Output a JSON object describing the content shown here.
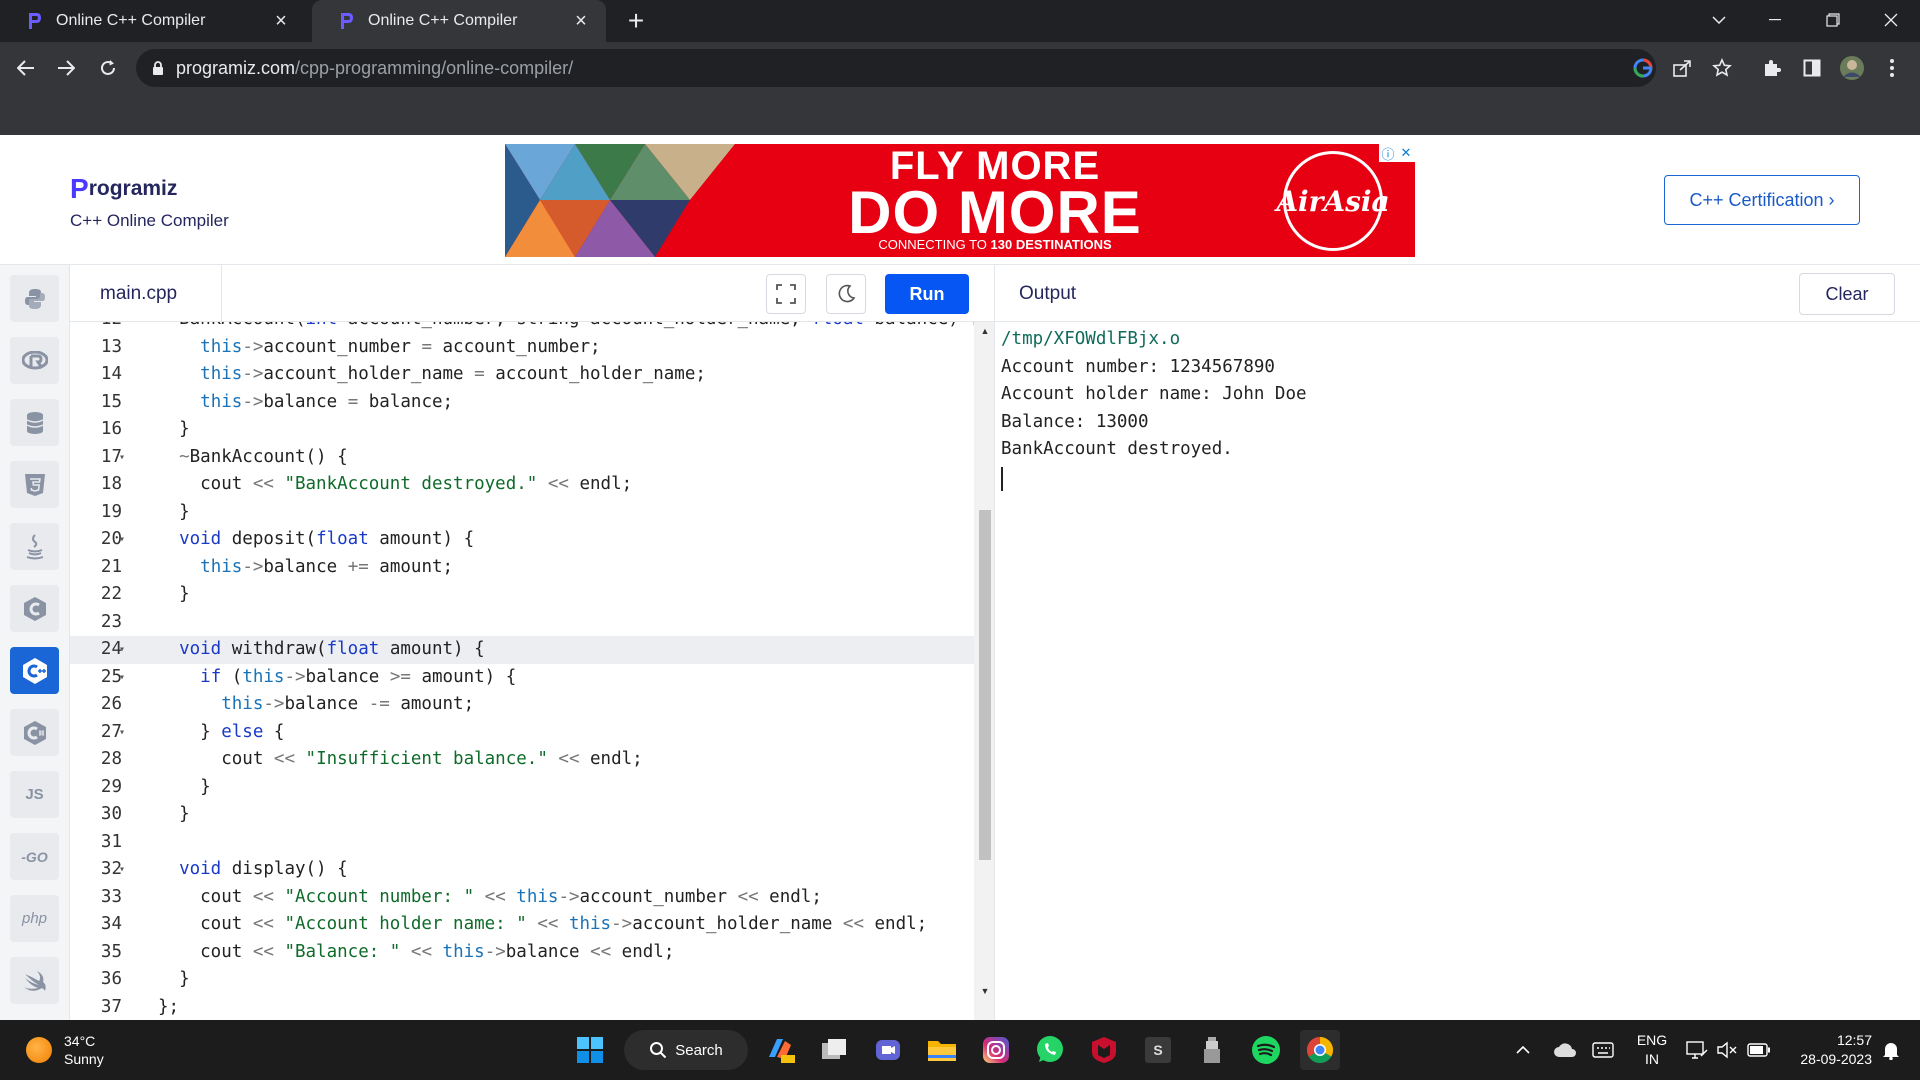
{
  "browser": {
    "tabs": [
      {
        "title": "Online C++ Compiler",
        "active": false
      },
      {
        "title": "Online C++ Compiler",
        "active": true
      }
    ],
    "url_host": "programiz.com",
    "url_path": "/cpp-programming/online-compiler/"
  },
  "site": {
    "logo_text": "rogramiz",
    "logo_letter": "P",
    "subtitle": "C++ Online Compiler",
    "certification_label": "C++ Certification",
    "ad": {
      "line1": "FLY MORE",
      "line2": "DO MORE",
      "line3_prefix": "CONNECTING TO ",
      "line3_bold": "130 DESTINATIONS",
      "brand": "AirAsia"
    }
  },
  "languages": [
    {
      "name": "python",
      "label": ""
    },
    {
      "name": "r",
      "label": ""
    },
    {
      "name": "sql",
      "label": ""
    },
    {
      "name": "html",
      "label": ""
    },
    {
      "name": "java",
      "label": ""
    },
    {
      "name": "c",
      "label": ""
    },
    {
      "name": "cpp",
      "label": "",
      "active": true
    },
    {
      "name": "csharp",
      "label": ""
    },
    {
      "name": "javascript",
      "label": "JS"
    },
    {
      "name": "go",
      "label": "-GO"
    },
    {
      "name": "php",
      "label": "php"
    },
    {
      "name": "swift",
      "label": ""
    }
  ],
  "editor": {
    "file_name": "main.cpp",
    "run_label": "Run",
    "current_line": 24,
    "lines": [
      {
        "n": "12",
        "fold": false,
        "html": "  BankAccount(<span class=\"kw\">int</span> account_number, string account_holder_name, <span class=\"kw\">float</span> balance) {"
      },
      {
        "n": "13",
        "fold": false,
        "html": "    <span class=\"th\">this</span><span class=\"op\">-></span>account_number <span class=\"op\">=</span> account_number;"
      },
      {
        "n": "14",
        "fold": false,
        "html": "    <span class=\"th\">this</span><span class=\"op\">-></span>account_holder_name <span class=\"op\">=</span> account_holder_name;"
      },
      {
        "n": "15",
        "fold": false,
        "html": "    <span class=\"th\">this</span><span class=\"op\">-></span>balance <span class=\"op\">=</span> balance;"
      },
      {
        "n": "16",
        "fold": false,
        "html": "  }"
      },
      {
        "n": "17",
        "fold": true,
        "html": "  <span class=\"op\">~</span>BankAccount() {"
      },
      {
        "n": "18",
        "fold": false,
        "html": "    cout <span class=\"op\"><<</span> <span class=\"str\">\"BankAccount destroyed.\"</span> <span class=\"op\"><<</span> endl;"
      },
      {
        "n": "19",
        "fold": false,
        "html": "  }"
      },
      {
        "n": "20",
        "fold": true,
        "html": "  <span class=\"kw\">void</span> deposit(<span class=\"kw\">float</span> amount) {"
      },
      {
        "n": "21",
        "fold": false,
        "html": "    <span class=\"th\">this</span><span class=\"op\">-></span>balance <span class=\"op\">+=</span> amount;"
      },
      {
        "n": "22",
        "fold": false,
        "html": "  }"
      },
      {
        "n": "23",
        "fold": false,
        "html": ""
      },
      {
        "n": "24",
        "fold": true,
        "html": "  <span class=\"kw\">void</span> withdraw(<span class=\"kw\">float</span> amount) {"
      },
      {
        "n": "25",
        "fold": true,
        "html": "    <span class=\"kw\">if</span> (<span class=\"th\">this</span><span class=\"op\">-></span>balance <span class=\"op\">>=</span> amount) {"
      },
      {
        "n": "26",
        "fold": false,
        "html": "      <span class=\"th\">this</span><span class=\"op\">-></span>balance <span class=\"op\">-=</span> amount;"
      },
      {
        "n": "27",
        "fold": true,
        "html": "    } <span class=\"kw\">else</span> {"
      },
      {
        "n": "28",
        "fold": false,
        "html": "      cout <span class=\"op\"><<</span> <span class=\"str\">\"Insufficient balance.\"</span> <span class=\"op\"><<</span> endl;"
      },
      {
        "n": "29",
        "fold": false,
        "html": "    }"
      },
      {
        "n": "30",
        "fold": false,
        "html": "  }"
      },
      {
        "n": "31",
        "fold": false,
        "html": ""
      },
      {
        "n": "32",
        "fold": true,
        "html": "  <span class=\"kw\">void</span> display() {"
      },
      {
        "n": "33",
        "fold": false,
        "html": "    cout <span class=\"op\"><<</span> <span class=\"str\">\"Account number: \"</span> <span class=\"op\"><<</span> <span class=\"th\">this</span><span class=\"op\">-></span>account_number <span class=\"op\"><<</span> endl;"
      },
      {
        "n": "34",
        "fold": false,
        "html": "    cout <span class=\"op\"><<</span> <span class=\"str\">\"Account holder name: \"</span> <span class=\"op\"><<</span> <span class=\"th\">this</span><span class=\"op\">-></span>account_holder_name <span class=\"op\"><<</span> endl;"
      },
      {
        "n": "35",
        "fold": false,
        "html": "    cout <span class=\"op\"><<</span> <span class=\"str\">\"Balance: \"</span> <span class=\"op\"><<</span> <span class=\"th\">this</span><span class=\"op\">-></span>balance <span class=\"op\"><<</span> endl;"
      },
      {
        "n": "36",
        "fold": false,
        "html": "  }"
      },
      {
        "n": "37",
        "fold": false,
        "html": "};"
      }
    ]
  },
  "output": {
    "title": "Output",
    "clear_label": "Clear",
    "lines": [
      "/tmp/XFOWdlFBjx.o",
      "Account number: 1234567890",
      "Account holder name: John Doe",
      "Balance: 13000",
      "BankAccount destroyed."
    ]
  },
  "taskbar": {
    "temperature": "34°C",
    "weather": "Sunny",
    "search_label": "Search",
    "language": "ENG",
    "region": "IN",
    "time": "12:57",
    "date": "28-09-2023"
  }
}
